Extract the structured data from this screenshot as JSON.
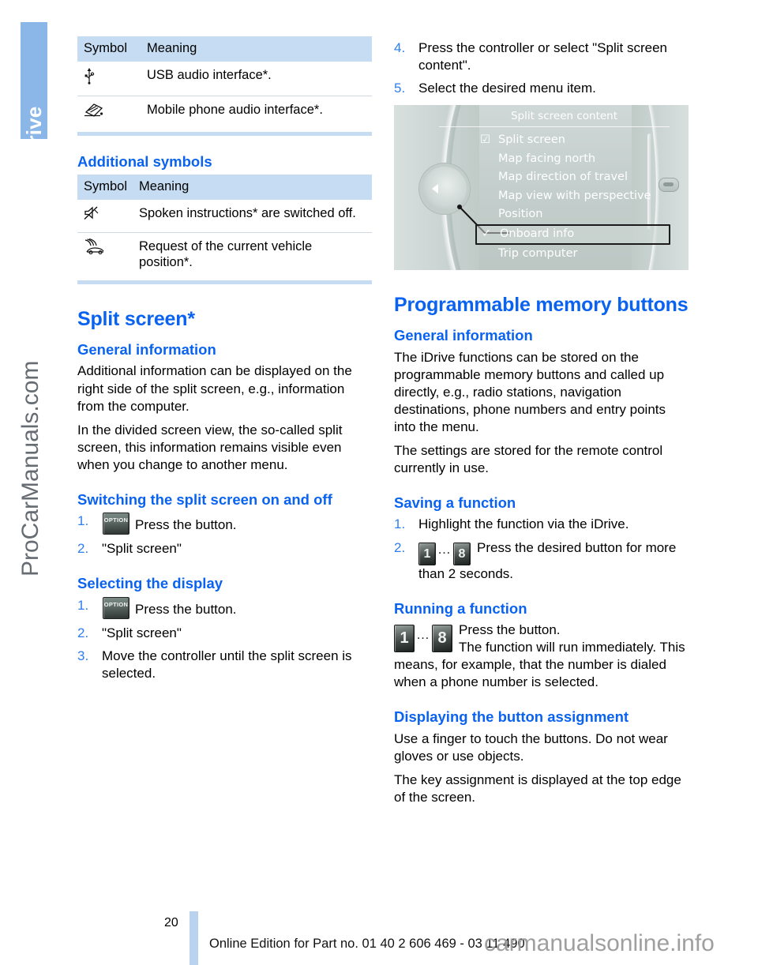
{
  "chapter": {
    "tab_label": "iDrive"
  },
  "watermarks": {
    "side": "ProCarManuals.com",
    "footer": "carmanualsonline.info"
  },
  "left_column": {
    "table_one": {
      "headers": [
        "Symbol",
        "Meaning"
      ],
      "rows": [
        {
          "symbol_icon": "usb-icon",
          "symbol_glyph": "ψ",
          "meaning": "USB audio interface*."
        },
        {
          "symbol_icon": "mobile-phone-audio-icon",
          "symbol_glyph": "✐",
          "meaning": "Mobile phone audio interface*."
        }
      ]
    },
    "heading_additional_symbols": "Additional symbols",
    "table_two": {
      "headers": [
        "Symbol",
        "Meaning"
      ],
      "rows": [
        {
          "symbol_icon": "speaker-muted-icon",
          "symbol_glyph": "🔇",
          "meaning": "Spoken instructions* are switched off."
        },
        {
          "symbol_icon": "vehicle-position-request-icon",
          "symbol_glyph": "⛐",
          "meaning": "Request of the current vehicle position*."
        }
      ]
    },
    "section_split_screen": {
      "title": "Split screen*",
      "general_information": {
        "heading": "General information",
        "paragraphs": [
          "Additional information can be displayed on the right side of the split screen, e.g., information from the computer.",
          "In the divided screen view, the so-called split screen, this information remains visible even when you change to another menu."
        ]
      },
      "switching": {
        "heading": "Switching the split screen on and off",
        "steps": [
          {
            "button": "OPTION",
            "text": "Press the button."
          },
          {
            "button": "",
            "text": "\"Split screen\""
          }
        ]
      },
      "selecting": {
        "heading": "Selecting the display",
        "steps": [
          {
            "button": "OPTION",
            "text": "Press the button."
          },
          {
            "button": "",
            "text": "\"Split screen\""
          },
          {
            "button": "",
            "text": "Move the controller until the split screen is selected."
          }
        ]
      }
    }
  },
  "right_column": {
    "continued_steps": [
      "Press the controller or select \"Split screen content\".",
      "Select the desired menu item."
    ],
    "idrive_screen": {
      "title": "Split screen content",
      "items": [
        {
          "label": "Split screen",
          "mark": "checkbox",
          "selected": false
        },
        {
          "label": "Map facing north",
          "mark": "",
          "selected": false
        },
        {
          "label": "Map direction of travel",
          "mark": "",
          "selected": false
        },
        {
          "label": "Map view with perspective",
          "mark": "",
          "selected": false
        },
        {
          "label": "Position",
          "mark": "",
          "selected": false
        },
        {
          "label": "Onboard info",
          "mark": "check",
          "selected": true
        },
        {
          "label": "Trip computer",
          "mark": "",
          "selected": false
        }
      ]
    },
    "section_memory_buttons": {
      "title": "Programmable memory buttons",
      "general_information": {
        "heading": "General information",
        "paragraphs": [
          "The iDrive functions can be stored on the programmable memory buttons and called up directly, e.g., radio stations, navigation destinations, phone numbers and entry points into the menu.",
          "The settings are stored for the remote control currently in use."
        ]
      },
      "saving": {
        "heading": "Saving a function",
        "steps": [
          {
            "keys": "",
            "text": "Highlight the function via the iDrive."
          },
          {
            "keys": "1...8",
            "text": "Press the desired button for more than 2 seconds."
          }
        ],
        "key_first": "1",
        "key_dots": "…",
        "key_last": "8"
      },
      "running": {
        "heading": "Running a function",
        "key_first": "1",
        "key_dots": "…",
        "key_last": "8",
        "line_one": "Press the button.",
        "line_two": "The function will run immediately. This means, for example, that the number is dialed when a phone number is selected."
      },
      "displaying": {
        "heading": "Displaying the button assignment",
        "paragraphs": [
          "Use a finger to touch the buttons. Do not wear gloves or use objects.",
          "The key assignment is displayed at the top edge of the screen."
        ]
      }
    }
  },
  "footer": {
    "page_number": "20",
    "text": "Online Edition for Part no. 01 40 2 606 469 - 03 11 490"
  },
  "colors": {
    "accent_blue": "#0a63f0",
    "tab_blue": "#8ab6e8",
    "table_header": "#c5dcf2",
    "step_number": "#2f7ef0"
  }
}
